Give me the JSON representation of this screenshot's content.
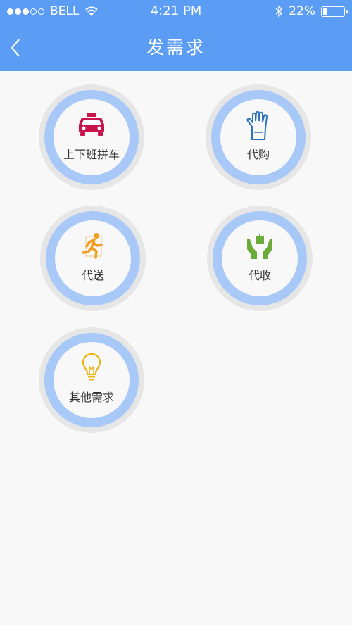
{
  "status_bar": {
    "carrier": "BELL",
    "time": "4:21 PM",
    "battery": "22%",
    "battery_level": 0.22
  },
  "nav": {
    "title": "发需求",
    "back_icon": "chevron-left-icon"
  },
  "items": [
    {
      "label": "上下班拼车",
      "icon": "taxi-icon",
      "color": "#c8144a"
    },
    {
      "label": "代购",
      "icon": "glove-icon",
      "color": "#2f73b8"
    },
    {
      "label": "代送",
      "icon": "running-man-icon",
      "color": "#f0a020"
    },
    {
      "label": "代收",
      "icon": "hands-gift-icon",
      "color": "#6aab3a"
    },
    {
      "label": "其他需求",
      "icon": "lightbulb-icon",
      "color": "#e8b61a"
    }
  ],
  "colors": {
    "header": "#5b9cf4",
    "ring": "#a8c8f8",
    "background": "#f8f8f8"
  }
}
